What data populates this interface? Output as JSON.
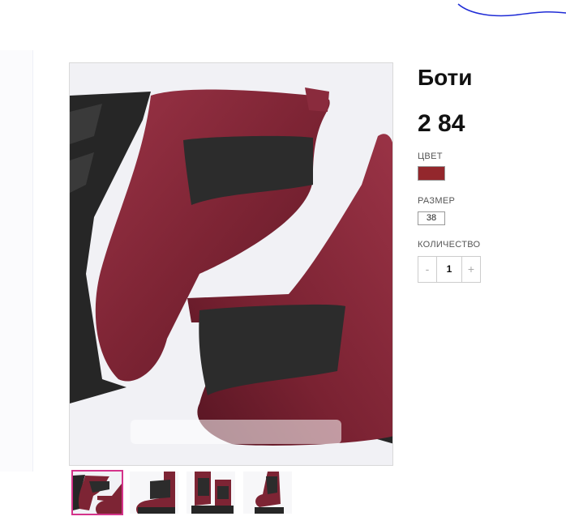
{
  "product": {
    "title": "Боти",
    "price": "2 84",
    "color_label": "ЦВЕТ",
    "color_value": "#93272c",
    "size_label": "РАЗМЕР",
    "size_value": "38",
    "quantity_label": "КОЛИЧЕСТВО",
    "quantity_value": "1",
    "minus": "-",
    "plus": "+"
  },
  "gallery": {
    "accent": "#d4338a",
    "boot_color": "#7d2434",
    "sole_color": "#262626",
    "thumbnails": [
      "thumb-1",
      "thumb-2",
      "thumb-3",
      "thumb-4"
    ],
    "active_thumbnail": 1
  }
}
